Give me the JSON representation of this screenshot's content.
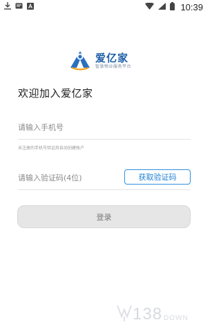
{
  "status_bar": {
    "time": "10:39",
    "left_icons": [
      "download-icon",
      "message-icon",
      "a-icon"
    ],
    "right_icons": [
      "wifi-icon",
      "signal-icon",
      "battery-icon"
    ]
  },
  "brand": {
    "name": "爱亿家",
    "slogan": "智慧物业服务平台",
    "color": "#1d5fa8"
  },
  "welcome_title": "欢迎加入爱亿家",
  "phone": {
    "placeholder": "请输入手机号",
    "value": ""
  },
  "phone_hint": "未注册的手机号验证后自动创建账户",
  "code": {
    "placeholder": "请输入验证码(4位)",
    "value": ""
  },
  "get_code_label": "获取验证码",
  "login_label": "登录",
  "watermark": {
    "text": "138",
    "sub": "DOWN"
  }
}
